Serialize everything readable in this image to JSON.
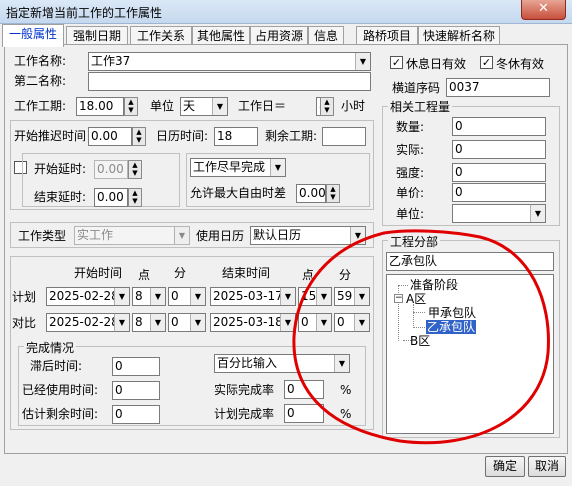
{
  "window": {
    "title": "指定新增当前工作的工作属性",
    "close": "✕"
  },
  "tabs": [
    "一般属性",
    "强制日期",
    "工作关系",
    "其他属性",
    "占用资源",
    "信息",
    "路桥项目",
    "快速解析名称"
  ],
  "general": {
    "work_name_label": "工作名称:",
    "work_name": "工作37",
    "second_name_label": "第二名称:",
    "second_name": "",
    "duration_label": "工作工期:",
    "duration": "18.00",
    "unit_label": "单位",
    "unit": "天",
    "workday_label": "工作日＝",
    "workday_hours": "8",
    "hours_suffix": "小时",
    "start_delay_label": "开始推迟时间",
    "start_delay": "0.00",
    "calendar_time_label": "日历时间:",
    "calendar_time": "18",
    "remaining_label": "剩余工期:",
    "remaining": "",
    "begin_extend_label": "开始延时:",
    "begin_extend": "0.00",
    "end_extend_label": "结束延时:",
    "end_extend": "0.00",
    "finish_mode": "工作尽早完成",
    "max_float_label": "允许最大自由时差",
    "max_float": "0.00",
    "work_type_label": "工作类型",
    "work_type": "实工作",
    "use_calendar_label": "使用日历",
    "calendar": "默认日历"
  },
  "schedule": {
    "start_time_label": "开始时间",
    "point_label": "点",
    "minute_label": "分",
    "end_time_label": "结束时间",
    "plan_label": "计划",
    "plan_start_date": "2025-02-28",
    "plan_start_hour": "8",
    "plan_start_min": "0",
    "plan_end_date": "2025-03-17",
    "plan_end_hour": "15",
    "plan_end_min": "59",
    "compare_label": "对比",
    "cmp_start_date": "2025-02-28",
    "cmp_start_hour": "8",
    "cmp_start_min": "0",
    "cmp_end_date": "2025-03-18",
    "cmp_end_hour": "0",
    "cmp_end_min": "0"
  },
  "completion": {
    "group_label": "完成情况",
    "lag_label": "滞后时间:",
    "lag": "0",
    "used_label": "已经使用时间:",
    "used": "0",
    "remain_est_label": "估计剩余时间:",
    "remain_est": "0",
    "input_mode": "百分比输入",
    "actual_rate_label": "实际完成率",
    "actual_rate": "0",
    "pct1": "%",
    "plan_rate_label": "计划完成率",
    "plan_rate": "0",
    "pct2": "%"
  },
  "right": {
    "holiday_valid": "休息日有效",
    "winter_valid": "冬休有效",
    "seq_label": "横道序码",
    "seq": "0037",
    "quantities_label": "相关工程量",
    "qty_label": "数量:",
    "qty": "0",
    "actual_label": "实际:",
    "actual": "0",
    "intensity_label": "强度:",
    "intensity": "0",
    "price_label": "单价:",
    "price": "0",
    "unit_label": "单位:",
    "unit": "",
    "division_label": "工程分部",
    "division": "乙承包队",
    "tree": [
      "准备阶段",
      "A区",
      "甲承包队",
      "乙承包队",
      "B区"
    ],
    "expanded": "−"
  },
  "buttons": {
    "ok": "确定",
    "cancel": "取消"
  },
  "icons": {
    "dropdown": "▼",
    "spin_up": "▲",
    "spin_down": "▼",
    "check": "✓"
  },
  "colors": {
    "annotation": "#e00000",
    "selection": "#3062c8"
  }
}
